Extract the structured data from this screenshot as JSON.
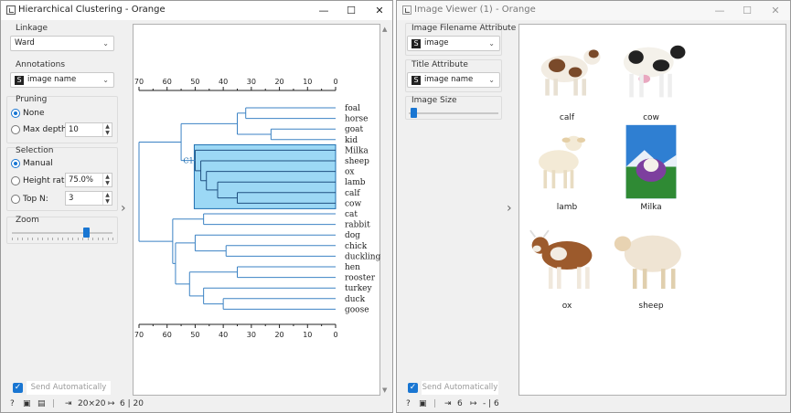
{
  "hc": {
    "title": "Hierarchical Clustering - Orange",
    "linkage_label": "Linkage",
    "linkage_value": "Ward",
    "annotations_label": "Annotations",
    "annotations_value": "image name",
    "pruning_label": "Pruning",
    "pruning_none": "None",
    "pruning_max_depth": "Max depth:",
    "max_depth_value": "10",
    "selection_label": "Selection",
    "sel_manual": "Manual",
    "sel_height_ratio": "Height ratio:",
    "height_ratio_value": "75.0%",
    "sel_top_n": "Top N:",
    "top_n_value": "3",
    "zoom_label": "Zoom",
    "zoom_level": 0.74,
    "send_auto": "Send Automatically",
    "status_in": "20×20",
    "status_out": "6 | 20",
    "cluster_label": "C1",
    "axis_ticks": [
      "70",
      "60",
      "50",
      "40",
      "30",
      "20",
      "10",
      "0"
    ],
    "leaves": [
      "foal",
      "horse",
      "goat",
      "kid",
      "Milka",
      "sheep",
      "ox",
      "lamb",
      "calf",
      "cow",
      "cat",
      "rabbit",
      "dog",
      "chick",
      "duckling",
      "hen",
      "rooster",
      "turkey",
      "duck",
      "goose"
    ]
  },
  "iv": {
    "title": "Image Viewer (1) - Orange",
    "filename_attr_label": "Image Filename Attribute",
    "filename_attr_value": "image",
    "title_attr_label": "Title Attribute",
    "title_attr_value": "image name",
    "size_label": "Image Size",
    "size_level": 0.05,
    "send_auto": "Send Automatically",
    "status_in": "6",
    "status_out": "- | 6",
    "images": [
      {
        "name": "calf"
      },
      {
        "name": "cow"
      },
      {
        "name": "lamb"
      },
      {
        "name": "Milka"
      },
      {
        "name": "ox"
      },
      {
        "name": "sheep"
      }
    ]
  },
  "icons": {
    "window": "window-icon",
    "minimize": "minimize-icon",
    "maximize": "maximize-icon",
    "close": "close-icon",
    "help": "help-icon",
    "save": "save-icon",
    "report": "report-icon",
    "input": "input-icon",
    "output": "output-icon"
  }
}
